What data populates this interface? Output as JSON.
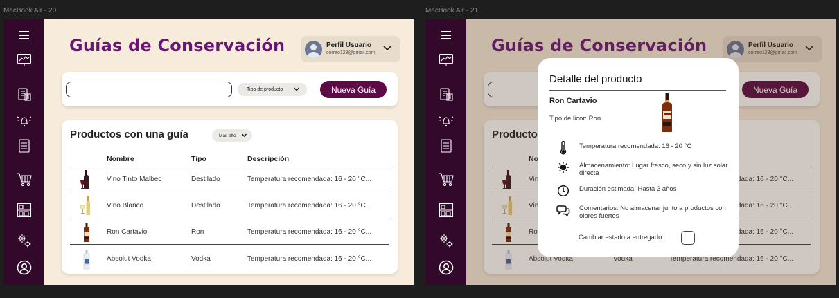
{
  "frames": [
    {
      "label": "MacBook Air - 20"
    },
    {
      "label": "MacBook Air - 21"
    }
  ],
  "page": {
    "title": "Guías de Conservación",
    "profile": {
      "name": "Perfil Usuario",
      "email": "correo123@gmail.com"
    },
    "search": {
      "value": "",
      "placeholder": ""
    },
    "type_filter_label": "Tipo de producto",
    "new_button_label": "Nueva Guía",
    "products_title": "Productos con una guía",
    "sort_label": "Más alto",
    "table": {
      "headers": {
        "name": "Nombre",
        "type": "Tipo",
        "description": "Descripción"
      },
      "rows": [
        {
          "name": "Vino Tinto Malbec",
          "type": "Destilado",
          "description": "Temperatura recomendada: 16 - 20 °C...",
          "image": "red-wine-icon"
        },
        {
          "name": "Vino Blanco",
          "type": "Destilado",
          "description": "Temperatura recomendada: 16 - 20 °C...",
          "image": "white-wine-icon"
        },
        {
          "name": "Ron Cartavio",
          "type": "Ron",
          "description": "Temperatura recomendada: 16 - 20 °C...",
          "image": "rum-bottle-icon"
        },
        {
          "name": "Absolut Vodka",
          "type": "Vodka",
          "description": "Temperatura recomendada: 16 - 20 °C...",
          "image": "vodka-bottle-icon"
        }
      ]
    }
  },
  "sidebar": {
    "icons": [
      "menu-icon",
      "dashboard-icon",
      "inventory-icon",
      "alarm-icon",
      "list-icon",
      "cart-icon",
      "warehouse-icon",
      "settings-icon",
      "user-icon"
    ]
  },
  "modal": {
    "title": "Detalle del producto",
    "product_name": "Ron Cartavio",
    "liquor_type": "Tipo de licor: Ron",
    "details": [
      {
        "icon": "thermometer-icon",
        "text": "Temperatura recomendada: 16 - 20 °C"
      },
      {
        "icon": "sun-icon",
        "text": "Almacenamiento: Lugar fresco, seco y sin luz solar directa"
      },
      {
        "icon": "clock-icon",
        "text": "Duración estimada: Hasta 3 años"
      },
      {
        "icon": "comment-icon",
        "text": "Comentarios: No almacenar junto a productos con olores fuertes"
      }
    ],
    "status_label": "Cambiar estado a entregado",
    "status_checked": false
  },
  "colors": {
    "sidebar": "#32082b",
    "background": "#f7ecdc",
    "title": "#6b1478",
    "button": "#5d0b45"
  }
}
